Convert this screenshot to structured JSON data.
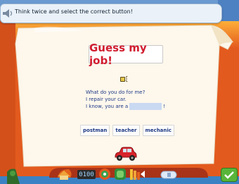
{
  "instruction": "Think twice and select the correct button!",
  "title": "Guess my job!",
  "dialog": {
    "line1": "What do you do for me?",
    "line2": "I repair your car.",
    "line3_prefix": "I know, you are a",
    "line3_suffix": "!"
  },
  "choices": [
    "postman",
    "teacher",
    "mechanic"
  ],
  "toolbar": {
    "counter": "0100"
  },
  "icons": {
    "speaker": "speaker-icon",
    "sound": "sound-icon",
    "car": "car-icon",
    "ok": "checkmark-icon"
  },
  "colors": {
    "title": "#d11c2e",
    "text": "#1f3a86",
    "wall": "#e35a1e",
    "blank": "#c9d9f2"
  }
}
